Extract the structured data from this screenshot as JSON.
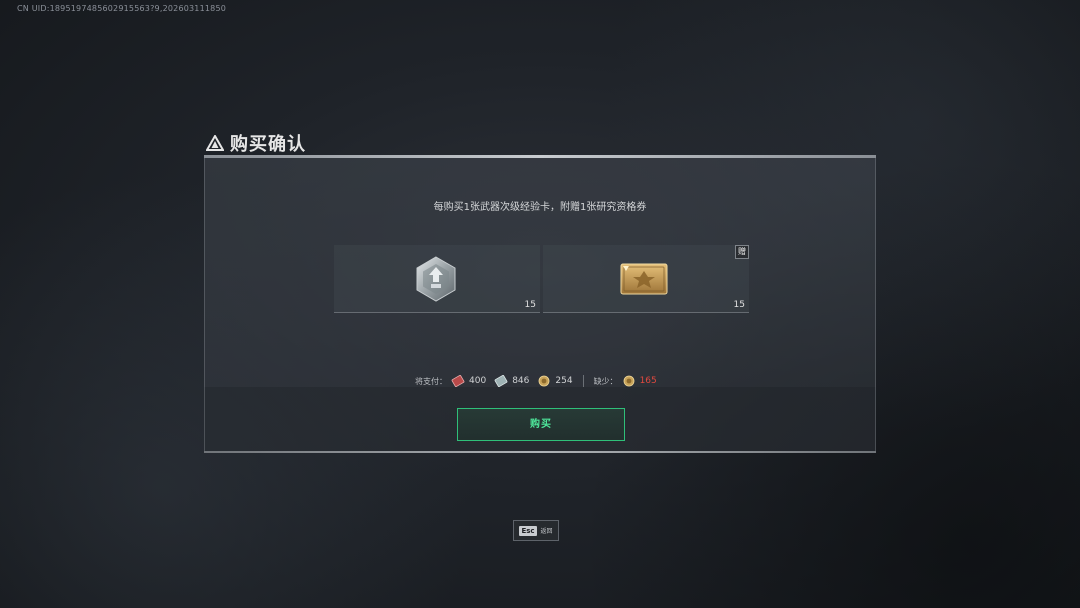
{
  "uid_text": "CN UID:1895197485602915563?9,202603111850",
  "dialog": {
    "title": "购买确认",
    "description": "每购买1张武器次级经验卡，附赠1张研究资格券",
    "items": [
      {
        "icon": "weapon-secondary-exp-card-icon",
        "count": "15"
      },
      {
        "icon": "research-qualification-ticket-icon",
        "count": "15",
        "badge": "赠"
      }
    ],
    "payment": {
      "label": "将支付：",
      "currencies": [
        {
          "icon": "red-ticket-icon",
          "value": "400"
        },
        {
          "icon": "silver-ticket-icon",
          "value": "846"
        },
        {
          "icon": "gold-coin-icon",
          "value": "254"
        }
      ],
      "shortage_label": "缺少：",
      "shortage": {
        "icon": "gold-coin-icon",
        "value": "165",
        "color": "#e0493f"
      }
    },
    "buy_button_label": "购买"
  },
  "esc": {
    "key": "Esc",
    "label": "返回"
  },
  "colors": {
    "accent_green": "#4ee69a",
    "shortage_red": "#e0493f"
  }
}
